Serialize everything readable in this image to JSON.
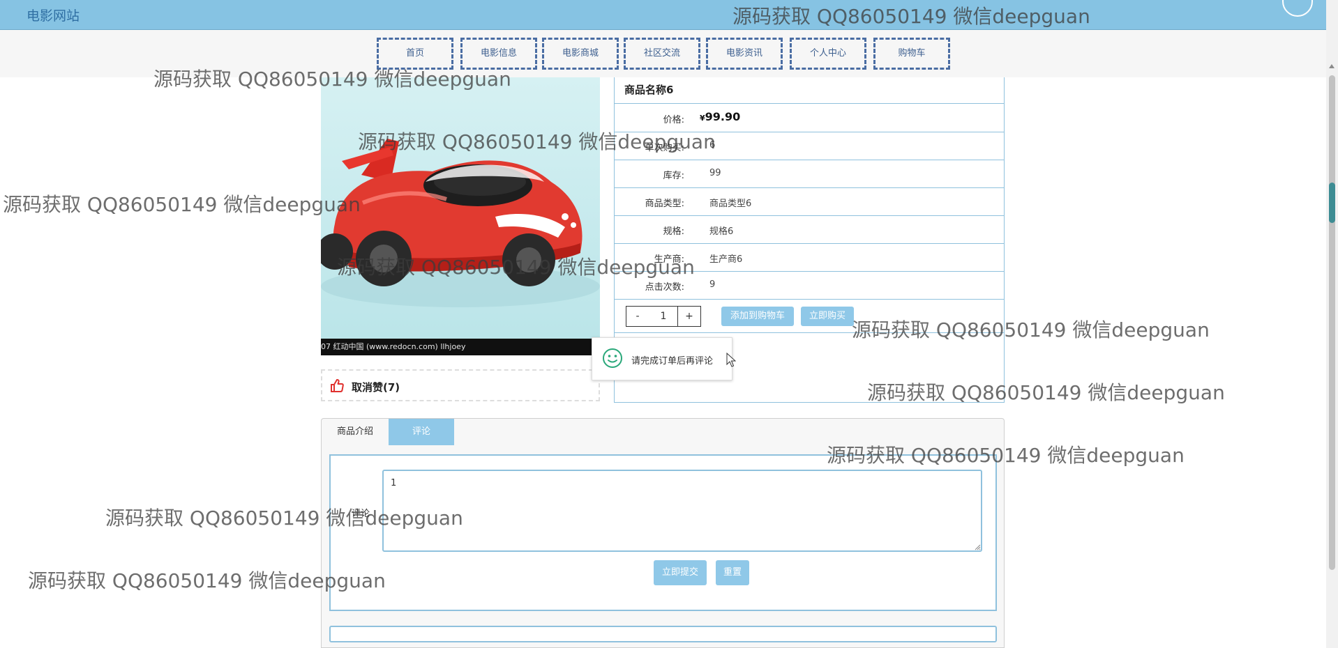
{
  "site_title": "电影网站",
  "nav": {
    "items": [
      "首页",
      "电影信息",
      "电影商城",
      "社区交流",
      "电影资讯",
      "个人中心",
      "购物车"
    ]
  },
  "product": {
    "name": "商品名称6",
    "image_caption": "07   红动中国 (www.redocn.com)   llhjoey",
    "price_label": "价格:",
    "price_symbol": "¥",
    "price_value": "99.90",
    "rows": [
      {
        "label": "单次购买:",
        "value": "6"
      },
      {
        "label": "库存:",
        "value": "99"
      },
      {
        "label": "商品类型:",
        "value": "商品类型6"
      },
      {
        "label": "规格:",
        "value": "规格6"
      },
      {
        "label": "生产商:",
        "value": "生产商6"
      },
      {
        "label": "点击次数:",
        "value": "9"
      }
    ],
    "like_text": "取消赞(7)"
  },
  "quantity": {
    "minus": "-",
    "value": "1",
    "plus": "+"
  },
  "buttons": {
    "add_to_cart": "添加到购物车",
    "buy_now": "立即购买",
    "submit": "立即提交",
    "reset": "重置"
  },
  "toast": {
    "message": "请完成订单后再评论"
  },
  "tabs": {
    "intro": "商品介绍",
    "comment": "评论"
  },
  "comment_form": {
    "label": "评论",
    "value": "1"
  },
  "watermark": "源码获取 QQ86050149 微信deepguan",
  "colors": {
    "topbar": "#86c3e3",
    "accent": "#8fc8e8",
    "border": "#8fc1dd",
    "nav_border": "#4a6da3",
    "like_icon": "#e0312e",
    "toast_icon": "#2aa87a"
  }
}
